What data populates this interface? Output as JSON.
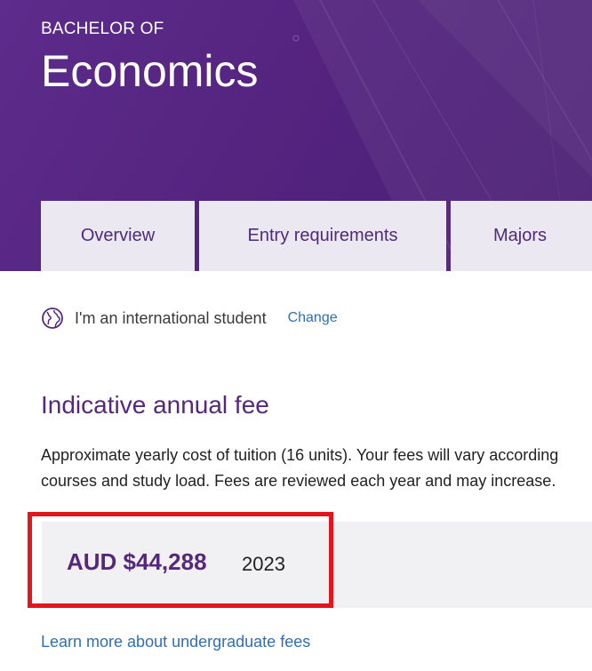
{
  "hero": {
    "eyebrow": "BACHELOR OF",
    "title": "Economics"
  },
  "tabs": [
    {
      "label": "Overview"
    },
    {
      "label": "Entry requirements"
    },
    {
      "label": "Majors"
    }
  ],
  "student": {
    "icon": "globe-icon",
    "label": "I'm an international student",
    "change_label": "Change"
  },
  "fees": {
    "heading": "Indicative annual fee",
    "description_line1": "Approximate yearly cost of tuition (16 units). Your fees will vary according",
    "description_line2": "courses and study load. Fees are reviewed each year and may increase.",
    "amount": "AUD $44,288",
    "year": "2023",
    "learn_more": "Learn more about undergraduate fees"
  },
  "colors": {
    "brand_purple": "#55287e",
    "tab_background": "#ece8f2",
    "link_blue": "#2f6fb6",
    "highlight_red": "#e3161e",
    "fee_box_background": "#f1f0f2"
  }
}
